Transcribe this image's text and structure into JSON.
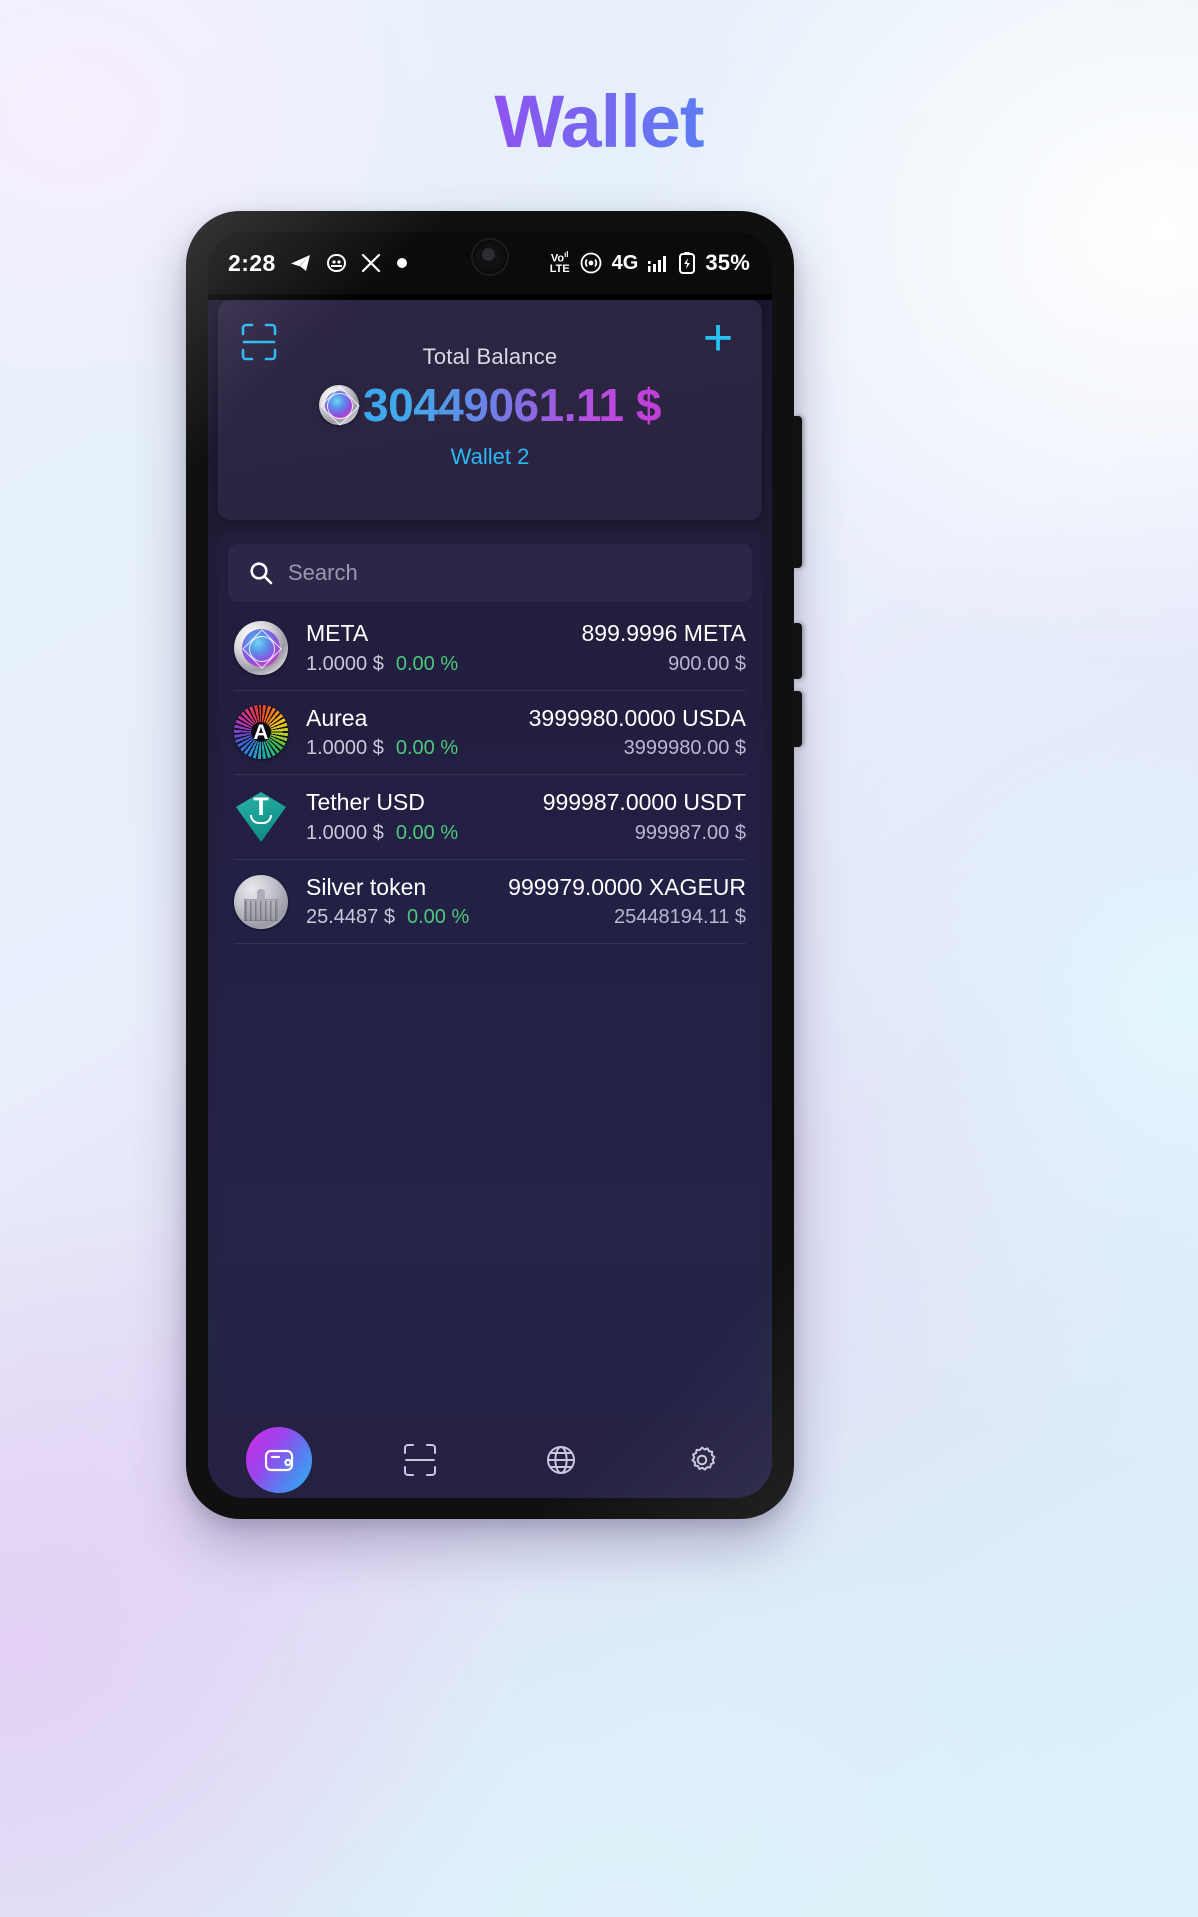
{
  "page": {
    "title": "Wallet"
  },
  "theme": {
    "title_gradient_from": "#F41CE8",
    "title_gradient_to": "#24C3F0",
    "accent_cyan": "#2BB8F5",
    "positive_green": "#4CC97A",
    "card_bg": "#2B2342",
    "app_bg": "#221D3B"
  },
  "status_bar": {
    "time": "2:28",
    "left_icons": [
      "telegram-icon",
      "app-icon",
      "x-icon",
      "dot-icon"
    ],
    "network_label": "VoLTE",
    "network_type": "4G",
    "right_icons": [
      "volte-icon",
      "hotspot-icon",
      "signal-icon",
      "battery-charging-icon"
    ],
    "battery_percent": "35%"
  },
  "header": {
    "scan_icon": "scan-icon",
    "add_icon": "plus-icon",
    "balance_label": "Total Balance",
    "balance_amount": "30449061.11 $",
    "balance_coin_icon": "meta-coin-icon",
    "wallet_name": "Wallet 2"
  },
  "search": {
    "icon": "search-icon",
    "placeholder": "Search",
    "value": ""
  },
  "tokens": [
    {
      "icon": "meta-coin-icon",
      "name": "META",
      "price": "1.0000 $",
      "change": "0.00 %",
      "amount": "899.9996 META",
      "value": "900.00 $"
    },
    {
      "icon": "aurea-coin-icon",
      "name": "Aurea",
      "price": "1.0000 $",
      "change": "0.00 %",
      "amount": "3999980.0000 USDA",
      "value": "3999980.00 $"
    },
    {
      "icon": "tether-coin-icon",
      "name": "Tether USD",
      "price": "1.0000 $",
      "change": "0.00 %",
      "amount": "999987.0000 USDT",
      "value": "999987.00 $"
    },
    {
      "icon": "silver-coin-icon",
      "name": "Silver token",
      "price": "25.4487 $",
      "change": "0.00 %",
      "amount": "999979.0000 XAGEUR",
      "value": "25448194.11 $"
    }
  ],
  "bottom_nav": [
    {
      "icon": "wallet-icon",
      "name": "wallet",
      "active": true
    },
    {
      "icon": "scan-icon",
      "name": "scan",
      "active": false
    },
    {
      "icon": "globe-icon",
      "name": "browser",
      "active": false
    },
    {
      "icon": "gear-icon",
      "name": "settings",
      "active": false
    }
  ]
}
